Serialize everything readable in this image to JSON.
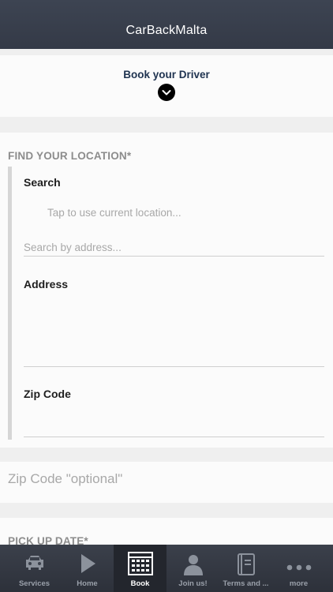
{
  "app": {
    "title": "CarBackMalta"
  },
  "book": {
    "title": "Book your Driver"
  },
  "location": {
    "section_label": "FIND YOUR LOCATION*",
    "search_label": "Search",
    "current_location_hint": "Tap to use current location...",
    "search_placeholder": "Search by address...",
    "address_label": "Address",
    "zip_label": "Zip Code"
  },
  "zip_optional": {
    "placeholder": "Zip Code \"optional\""
  },
  "pickup": {
    "section_label": "PICK UP DATE*"
  },
  "tabs": [
    {
      "label": "Services",
      "icon": "car-icon"
    },
    {
      "label": "Home",
      "icon": "play-icon"
    },
    {
      "label": "Book",
      "icon": "calendar-icon"
    },
    {
      "label": "Join us!",
      "icon": "person-icon"
    },
    {
      "label": "Terms and ...",
      "icon": "document-icon"
    },
    {
      "label": "more",
      "icon": "more-icon"
    }
  ],
  "active_tab": "Book"
}
